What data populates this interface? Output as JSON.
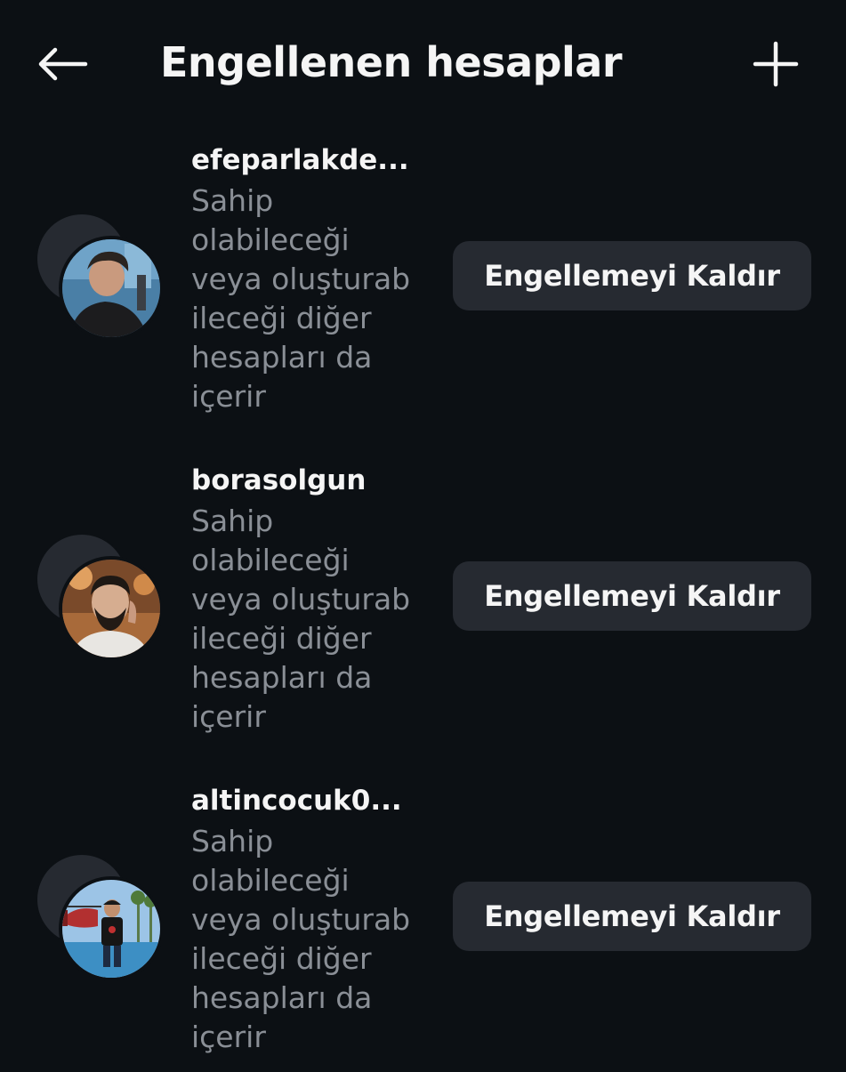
{
  "header": {
    "title": "Engellenen hesaplar",
    "back_icon": "arrow-left-icon",
    "add_icon": "plus-icon"
  },
  "accounts": [
    {
      "username": "efeparlakde...",
      "subtitle_lines": [
        "Sahip",
        "olabileceği",
        "veya oluşturab",
        "ileceği diğer",
        "hesapları da",
        "içerir"
      ],
      "button_label": "Engellemeyi Kaldır"
    },
    {
      "username": "borasolgun",
      "subtitle_lines": [
        "Sahip",
        "olabileceği",
        "veya oluşturab",
        "ileceği diğer",
        "hesapları da",
        "içerir"
      ],
      "button_label": "Engellemeyi Kaldır"
    },
    {
      "username": "altincocuk0...",
      "subtitle_lines": [
        "Sahip",
        "olabileceği",
        "veya oluşturab",
        "ileceği diğer",
        "hesapları da",
        "içerir"
      ],
      "button_label": "Engellemeyi Kaldır"
    }
  ],
  "colors": {
    "background": "#0c1014",
    "button_bg": "#262a31",
    "primary_text": "#f5f5f5",
    "secondary_text": "#8a8f96"
  }
}
